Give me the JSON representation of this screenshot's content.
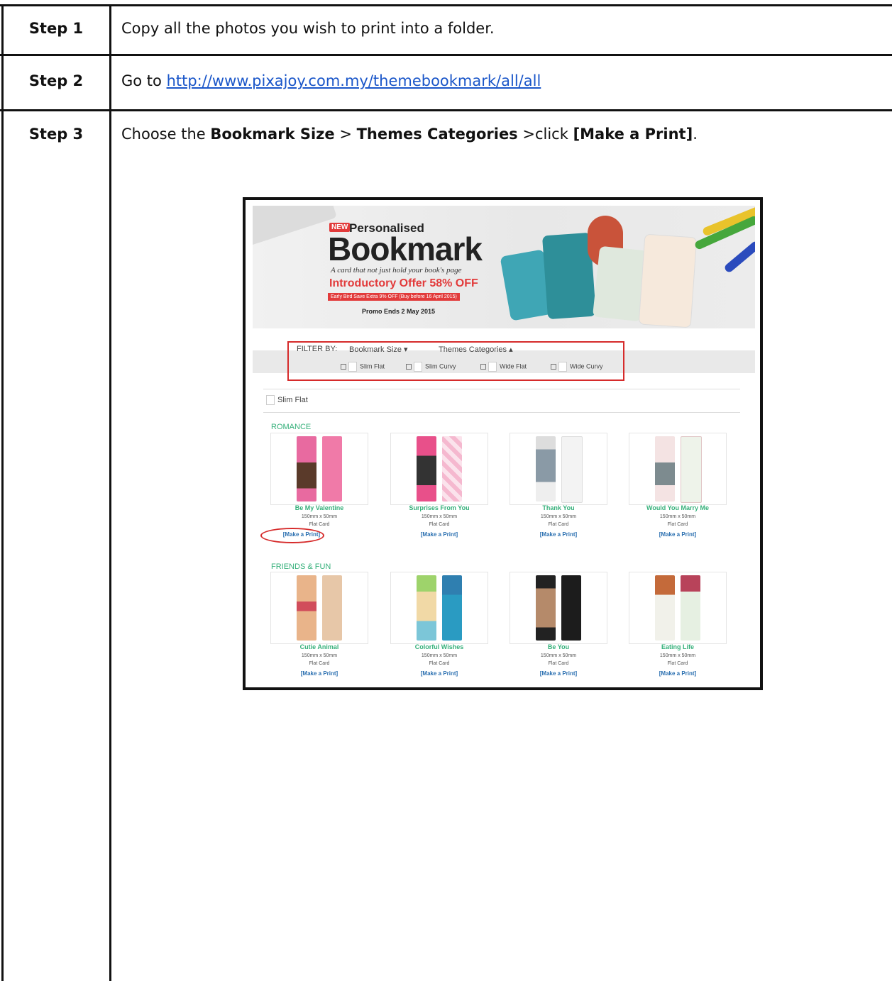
{
  "steps": [
    {
      "label": "Step 1",
      "text": "Copy all the photos you wish to print into a folder."
    },
    {
      "label": "Step 2",
      "prefix": "Go to ",
      "link": "http://www.pixajoy.com.my/themebookmark/all/all"
    },
    {
      "label": "Step 3",
      "p1": "Choose the ",
      "b1": "Bookmark Size",
      "p2": " > ",
      "b2": "Themes Categories",
      "p3": " >click ",
      "b3": "[Make a Print]",
      "p4": "."
    }
  ],
  "screenshot": {
    "banner": {
      "new_tag": "NEW",
      "personalised": "Personalised",
      "bookmark": "Bookmark",
      "tagline": "A card that not just hold your book's page",
      "offer": "Introductory Offer 58% OFF",
      "early_bird": "Early Bird Save Extra 9% OFF (Buy before 16 April 2015)",
      "promo": "Promo Ends 2 May 2015"
    },
    "filter": {
      "label": "FILTER BY:",
      "bookmark_size": "Bookmark Size",
      "themes_categories": "Themes Categories",
      "options": [
        "Slim Flat",
        "Slim Curvy",
        "Wide Flat",
        "Wide Curvy"
      ]
    },
    "section": "Slim Flat",
    "categories": [
      {
        "name": "ROMANCE",
        "products": [
          {
            "name": "Be My Valentine",
            "size": "150mm x 50mm",
            "type": "Flat Card",
            "link": "[Make a Print]"
          },
          {
            "name": "Surprises From You",
            "size": "150mm x 50mm",
            "type": "Flat Card",
            "link": "[Make a Print]"
          },
          {
            "name": "Thank You",
            "size": "150mm x 50mm",
            "type": "Flat Card",
            "link": "[Make a Print]"
          },
          {
            "name": "Would You Marry Me",
            "size": "150mm x 50mm",
            "type": "Flat Card",
            "link": "[Make a Print]"
          }
        ]
      },
      {
        "name": "FRIENDS & FUN",
        "products": [
          {
            "name": "Cutie Animal",
            "size": "150mm x 50mm",
            "type": "Flat Card",
            "link": "[Make a Print]"
          },
          {
            "name": "Colorful Wishes",
            "size": "150mm x 50mm",
            "type": "Flat Card",
            "link": "[Make a Print]"
          },
          {
            "name": "Be You",
            "size": "150mm x 50mm",
            "type": "Flat Card",
            "link": "[Make a Print]"
          },
          {
            "name": "Eating Life",
            "size": "150mm x 50mm",
            "type": "Flat Card",
            "link": "[Make a Print]"
          }
        ]
      }
    ]
  }
}
